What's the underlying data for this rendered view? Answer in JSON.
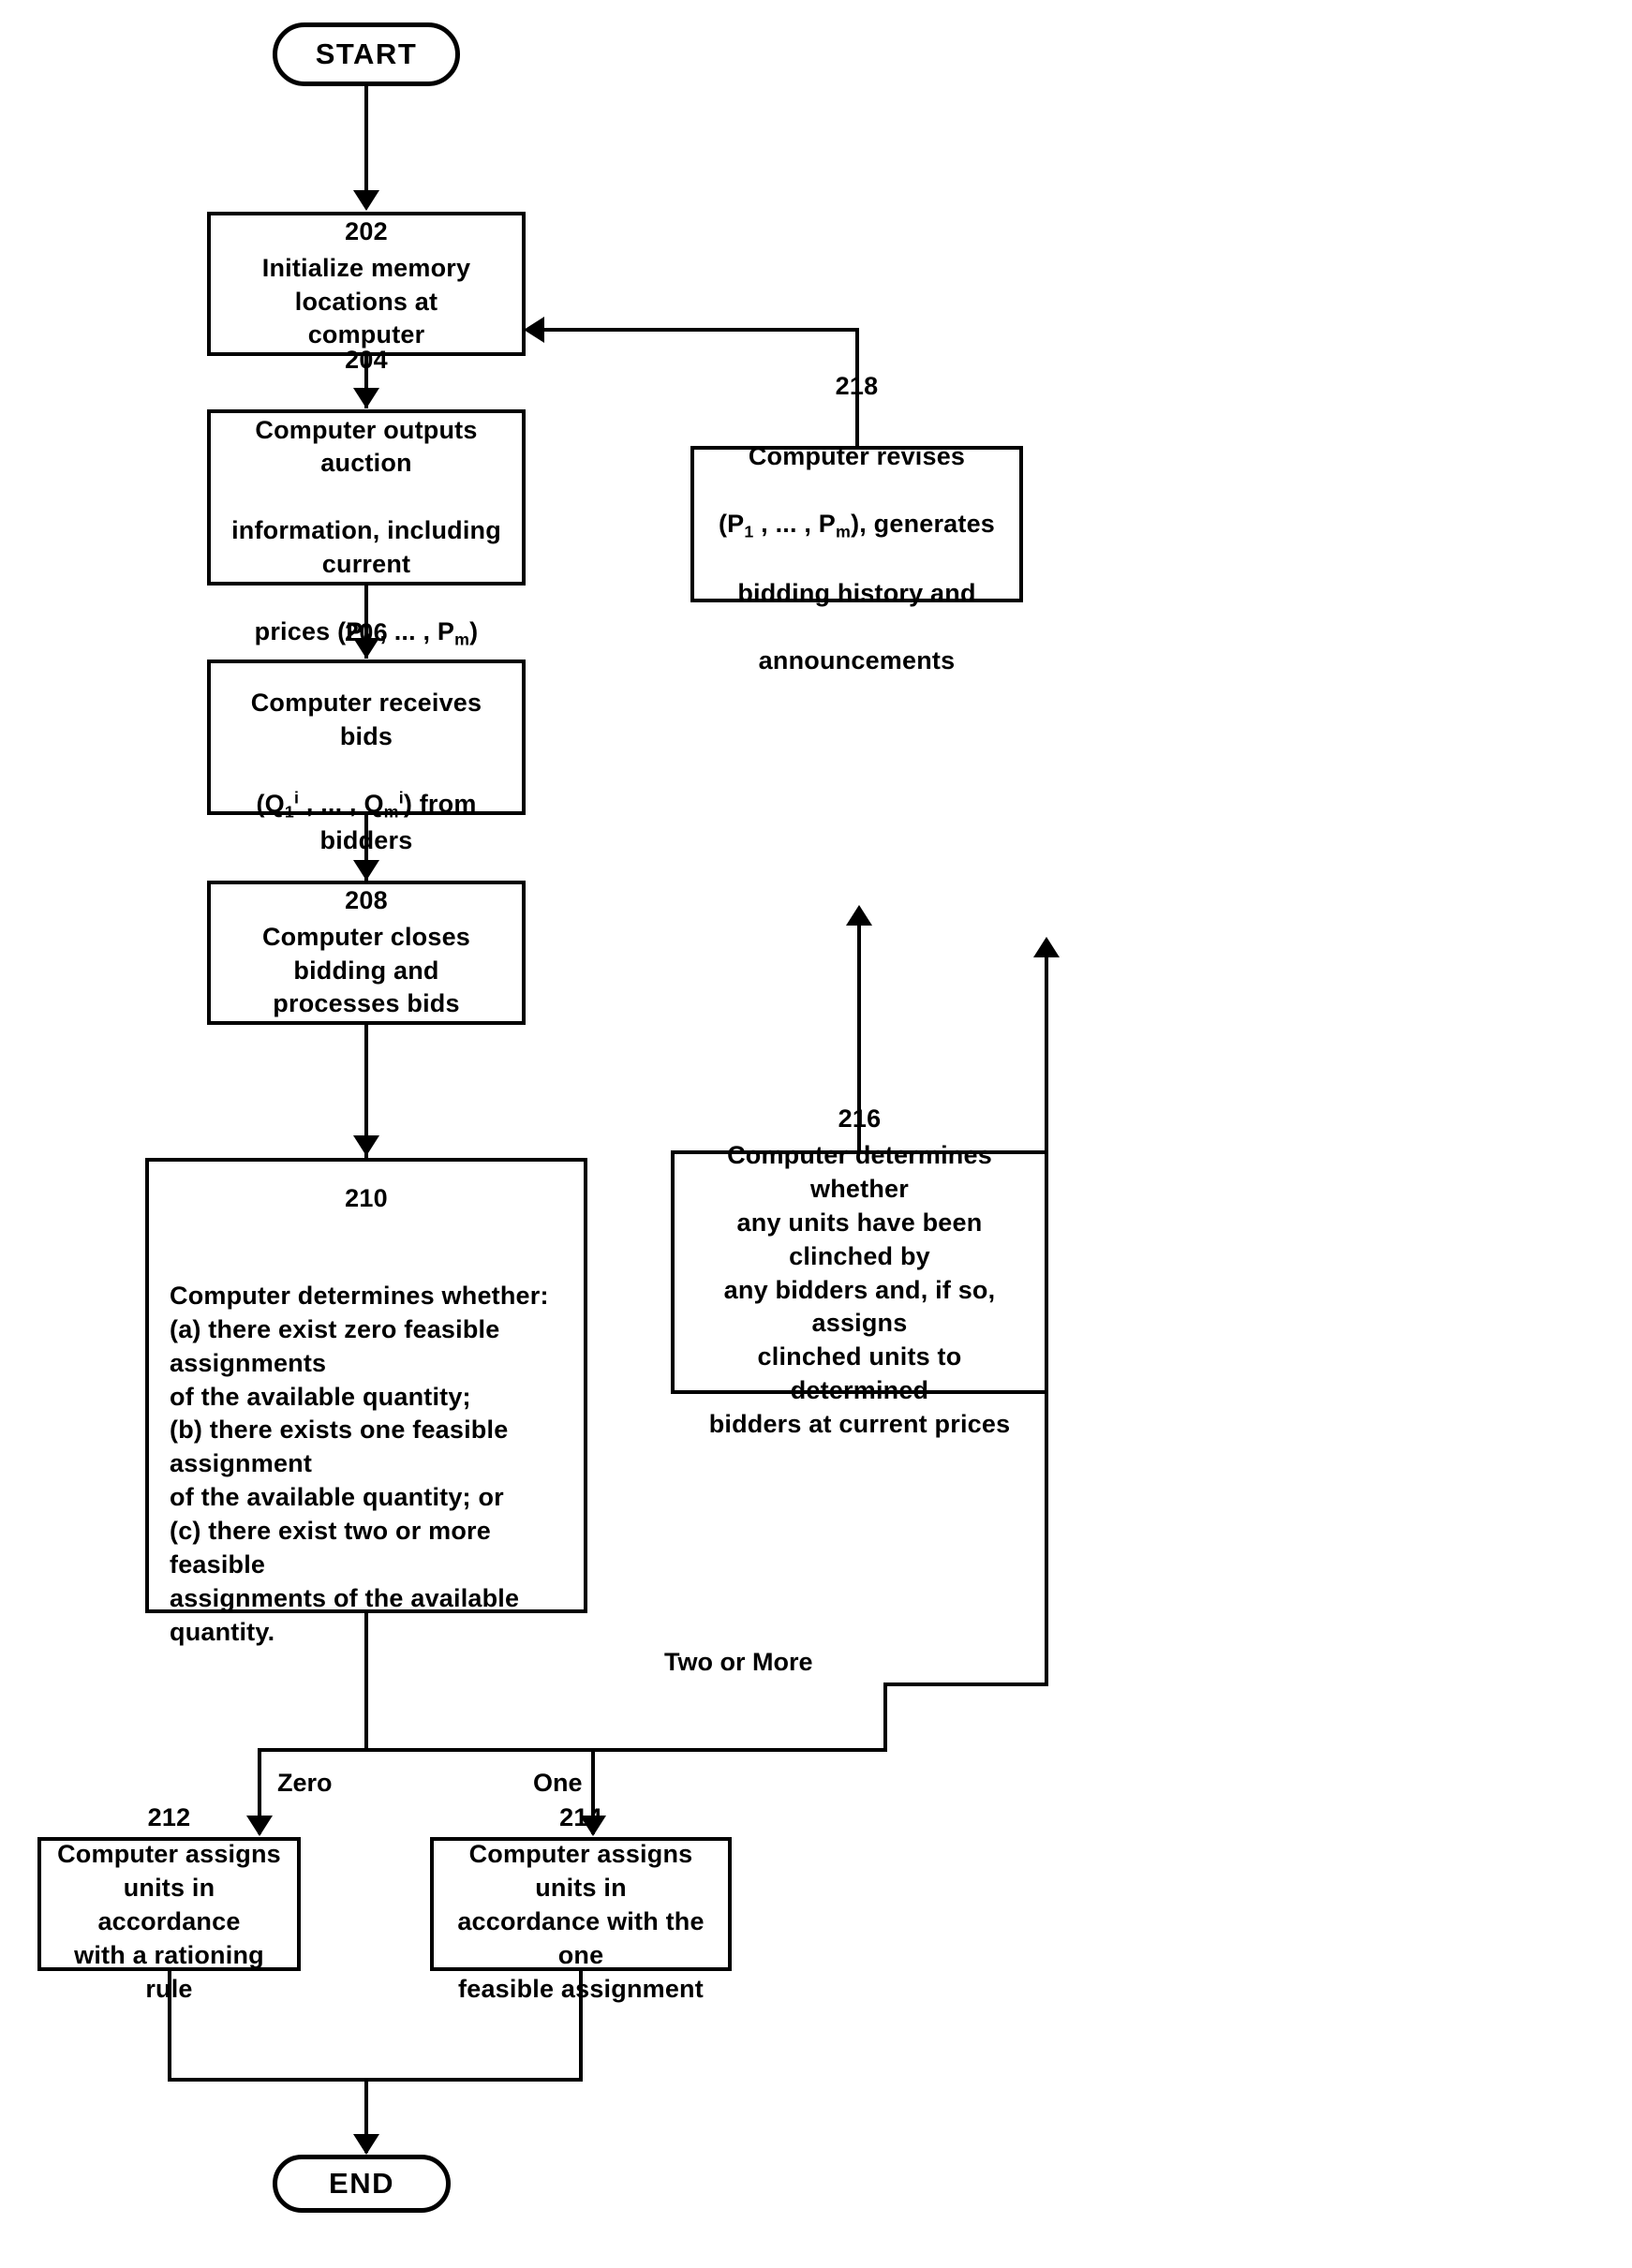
{
  "diagram": {
    "type": "flowchart",
    "title_visible": false,
    "nodes": [
      {
        "id": "start",
        "shape": "terminal",
        "ref": "",
        "label": "START"
      },
      {
        "id": "n202",
        "shape": "process",
        "ref": "202",
        "label": "Initialize memory locations at\ncomputer"
      },
      {
        "id": "n204",
        "shape": "process",
        "ref": "204",
        "label_line1": "Computer outputs auction",
        "label_line2": "information, including current",
        "label_line3_prefix": "prices (P",
        "label_line3_sub1": "1",
        "label_line3_mid": " , ... , P",
        "label_line3_sub2": "m",
        "label_line3_suffix": ")"
      },
      {
        "id": "n206",
        "shape": "process",
        "ref": "206",
        "label_line1": "Computer receives bids",
        "label_line2_prefix": "(Q",
        "label_line2_sub1": "1",
        "label_line2_sup1": "i",
        "label_line2_mid": " , ... , Q",
        "label_line2_sub2": "m",
        "label_line2_sup2": "i",
        "label_line2_suffix": ") from bidders"
      },
      {
        "id": "n208",
        "shape": "process",
        "ref": "208",
        "label": "Computer closes bidding and\nprocesses bids"
      },
      {
        "id": "n210",
        "shape": "process",
        "ref": "210",
        "intro": "Computer determines whether:",
        "option_a": "(a) there exist zero feasible assignments\nof the available quantity;",
        "option_b": "(b) there exists one feasible assignment\nof the available quantity; or",
        "option_c": "(c) there exist two or more feasible\nassignments of the available quantity."
      },
      {
        "id": "n212",
        "shape": "process",
        "ref": "212",
        "label": "Computer assigns\nunits in accordance\nwith a rationing rule"
      },
      {
        "id": "n214",
        "shape": "process",
        "ref": "214",
        "label": "Computer assigns units in\naccordance with the one\nfeasible assignment"
      },
      {
        "id": "n216",
        "shape": "process",
        "ref": "216",
        "label": "Computer determines whether\nany units have been clinched by\nany bidders and, if so, assigns\nclinched units to determined\nbidders at current prices"
      },
      {
        "id": "n218",
        "shape": "process",
        "ref": "218",
        "label_line1": "Computer revises",
        "label_line2_prefix": "(P",
        "label_line2_sub1": "1",
        "label_line2_mid": " , ... , P",
        "label_line2_sub2": "m",
        "label_line2_suffix": "), generates",
        "label_line3": "bidding history and",
        "label_line4": "announcements"
      },
      {
        "id": "end",
        "shape": "terminal",
        "ref": "",
        "label": "END"
      }
    ],
    "edge_labels": {
      "zero": "Zero",
      "one": "One",
      "two_or_more": "Two or More"
    },
    "colors": {
      "stroke": "#000000",
      "fill": "#ffffff",
      "text": "#000000"
    }
  }
}
